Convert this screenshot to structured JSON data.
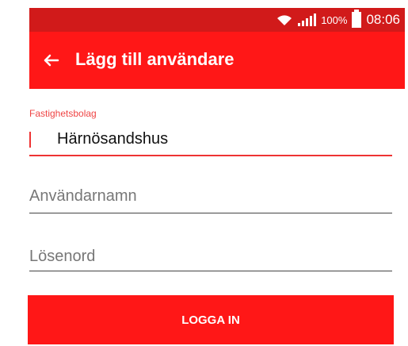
{
  "statusbar": {
    "battery_pct": "100%",
    "time": "08:06"
  },
  "appbar": {
    "title": "Lägg till användare"
  },
  "form": {
    "company_label": "Fastighetsbolag",
    "company_value": "Härnösandshus",
    "username_placeholder": "Användarnamn",
    "password_placeholder": "Lösenord"
  },
  "button": {
    "label": "LOGGA IN"
  },
  "colors": {
    "accent": "#ff1717",
    "status": "#d11a1a"
  },
  "icons": [
    "wifi-icon",
    "signal-icon",
    "battery-icon",
    "back-arrow-icon"
  ]
}
